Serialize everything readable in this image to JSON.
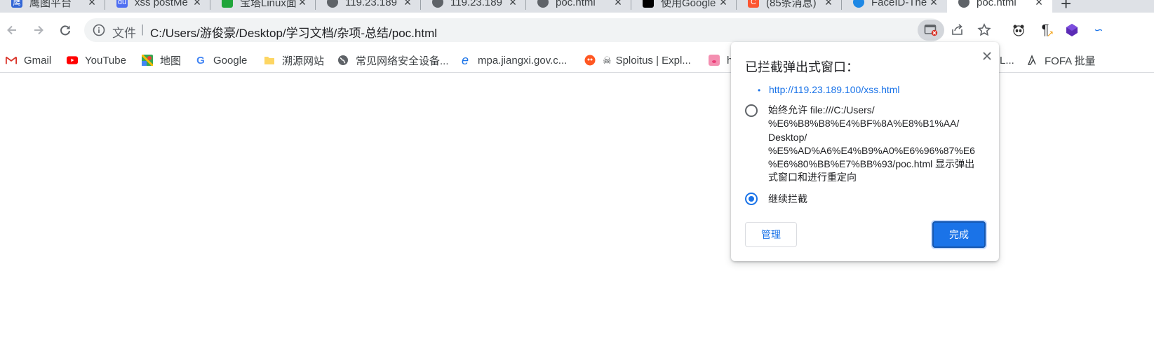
{
  "tabs": [
    {
      "title": "鹰图平台",
      "icon": "hunter-icon",
      "color": "#3367d6"
    },
    {
      "title": "xss postMe",
      "icon": "baidu-icon",
      "color": "#4e6ef2"
    },
    {
      "title": "宝塔Linux面",
      "icon": "baota-icon",
      "color": "#20a53a"
    },
    {
      "title": "119.23.189",
      "icon": "globe-icon",
      "color": "#5f6368"
    },
    {
      "title": "119.23.189",
      "icon": "globe-icon",
      "color": "#5f6368"
    },
    {
      "title": "poc.html",
      "icon": "globe-icon",
      "color": "#5f6368"
    },
    {
      "title": "使用Google",
      "icon": "notion-icon",
      "color": "#000000"
    },
    {
      "title": "(85条消息)",
      "icon": "csdn-icon",
      "color": "#fc5531"
    },
    {
      "title": "FaceID-The",
      "icon": "faceid-icon",
      "color": "#1e88e5"
    },
    {
      "title": "poc.html",
      "icon": "globe-icon",
      "color": "#5f6368"
    }
  ],
  "omnibox": {
    "scheme": "文件",
    "url": "C:/Users/游俊豪/Desktop/学习文档/杂项-总结/poc.html"
  },
  "bookmarks": [
    {
      "label": "Gmail",
      "icon": "gmail-icon"
    },
    {
      "label": "YouTube",
      "icon": "youtube-icon"
    },
    {
      "label": "地图",
      "icon": "maps-icon"
    },
    {
      "label": "Google",
      "icon": "google-icon"
    },
    {
      "label": "溯源网站",
      "icon": "folder-icon"
    },
    {
      "label": "常见网络安全设备...",
      "icon": "globe-icon"
    },
    {
      "label": "mpa.jiangxi.gov.c...",
      "icon": "ie-icon"
    },
    {
      "label": "Sploitus | Expl...",
      "icon": "sploitus-icon"
    },
    {
      "label": "h",
      "icon": "pig-icon"
    },
    {
      "label": "L...",
      "icon": "globe-icon"
    },
    {
      "label": "FOFA 批量",
      "icon": "fofa-icon"
    }
  ],
  "dialog": {
    "title": "已拦截弹出式窗口：",
    "popup_url": "http://119.23.189.100/xss.html",
    "option_allow_lines": [
      "始终允许 file:///C:/Users/",
      "%E6%B8%B8%E4%BF%8A%E8%B1%AA/",
      "Desktop/",
      "%E5%AD%A6%E4%B9%A0%E6%96%87%E6",
      "%E6%80%BB%E7%BB%93/poc.html 显示弹出",
      "式窗口和进行重定向"
    ],
    "option_block": "继续拦截",
    "selected_option": "继续拦截",
    "manage_label": "管理",
    "done_label": "完成"
  },
  "colors": {
    "accent": "#1a73e8",
    "tabstrip": "#dee1e6",
    "omnibox": "#f1f3f4"
  }
}
